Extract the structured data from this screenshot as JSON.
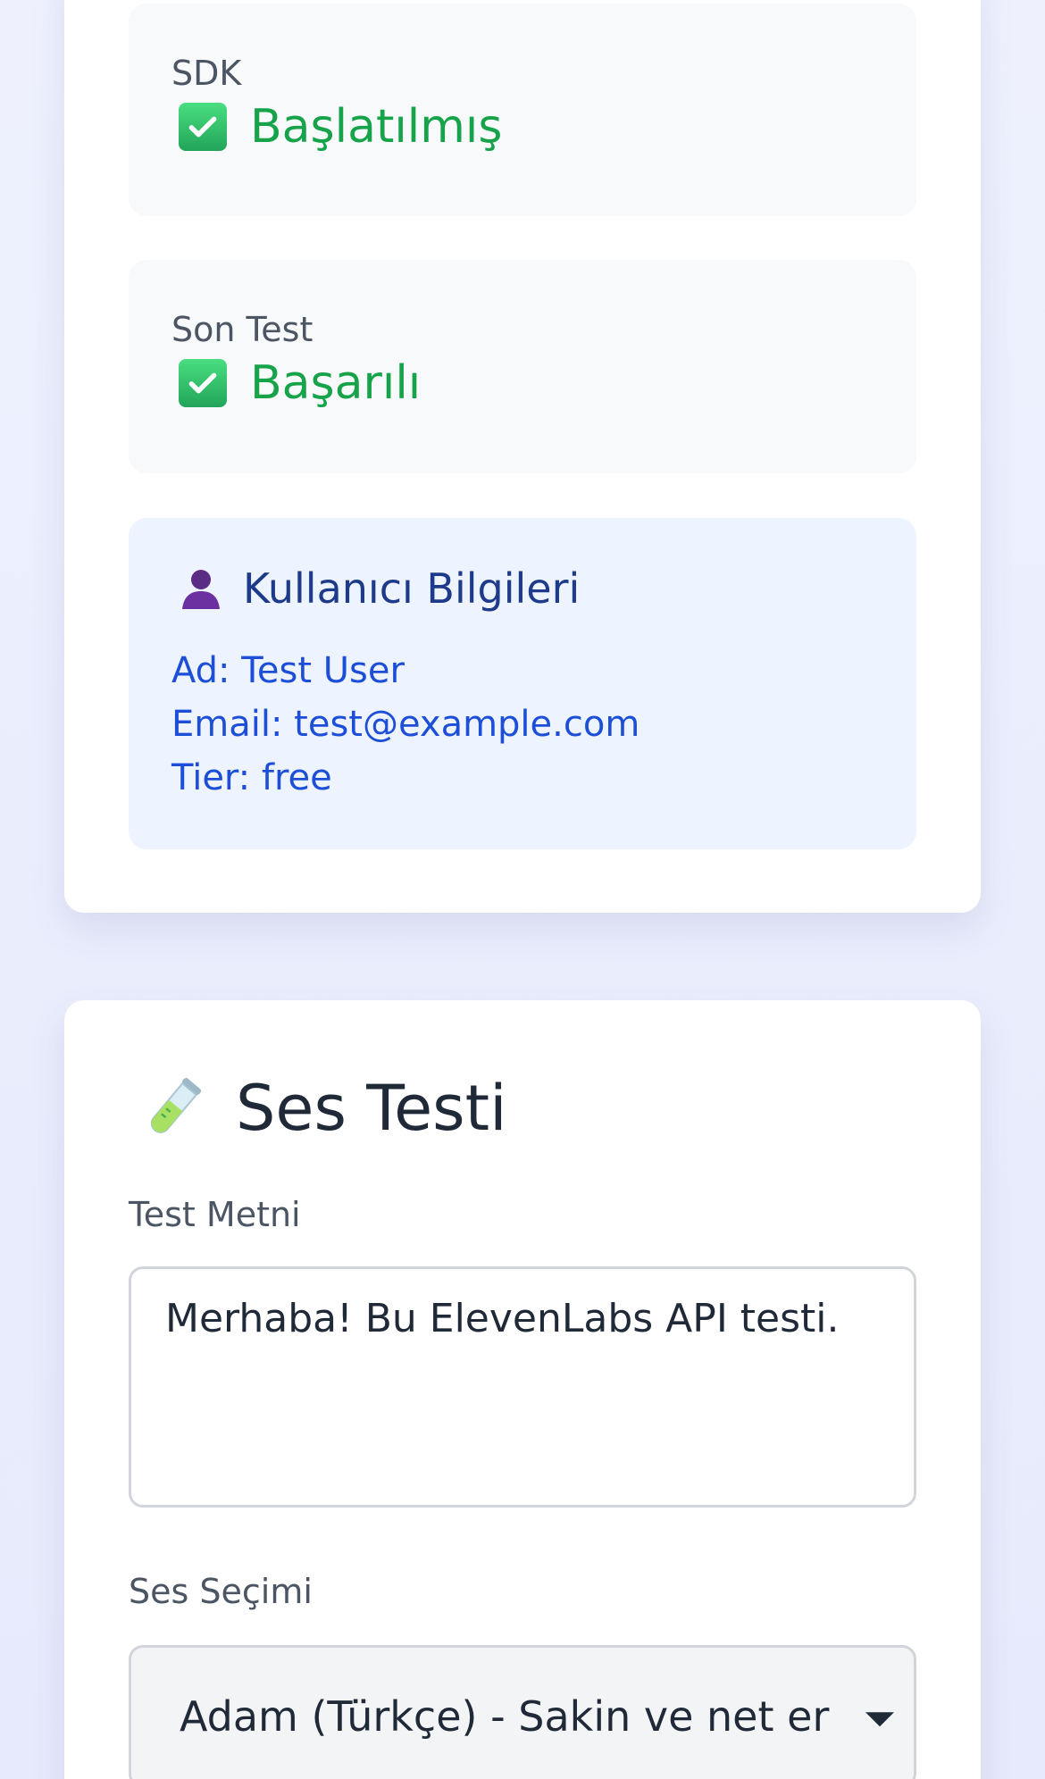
{
  "status": {
    "sdk": {
      "label": "SDK",
      "value": "Başlatılmış",
      "icon": "check-mark-icon"
    },
    "last_test": {
      "label": "Son Test",
      "value": "Başarılı",
      "icon": "check-mark-icon"
    }
  },
  "user_info": {
    "title": "Kullanıcı Bilgileri",
    "icon": "user-silhouette-icon",
    "name_line": "Ad: Test User",
    "email_line": "Email: test@example.com",
    "tier_line": "Tier: free"
  },
  "voice_test": {
    "title": "Ses Testi",
    "icon": "test-tube-icon",
    "text_label": "Test Metni",
    "text_value": "Merhaba! Bu ElevenLabs API testi.",
    "voice_label": "Ses Seçimi",
    "voice_selected": "Adam (Türkçe) - Sakin ve net erke"
  },
  "colors": {
    "success": "#16a34a",
    "info_bg": "#eef4ff",
    "info_text": "#1d4ed8"
  }
}
